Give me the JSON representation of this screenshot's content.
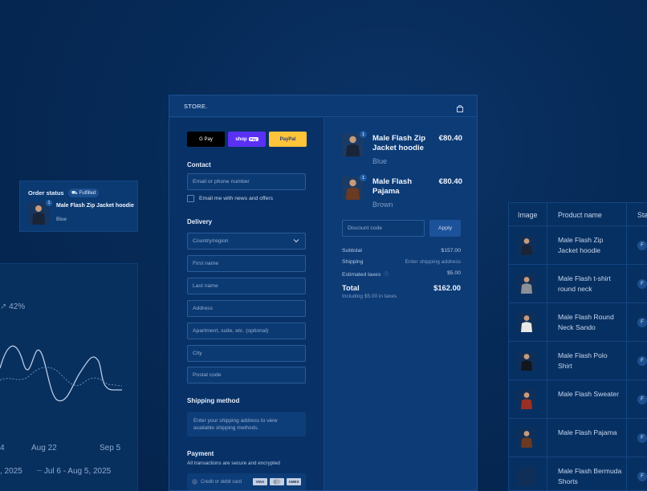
{
  "analytics": {
    "percent_label": "42%",
    "x_labels": [
      "4",
      "Aug 22",
      "Sep 5"
    ],
    "legend": [
      ", 2025",
      "Jul 6 - Aug 5, 2025"
    ]
  },
  "order_card": {
    "label": "Order status",
    "badge": "Fulfilled",
    "quantity": "1",
    "product": "Male Flash Zip Jacket hoodie",
    "variant": "Blue"
  },
  "checkout": {
    "brand": "STORE.",
    "express": {
      "gpay": "G Pay",
      "shoppay": "shop",
      "paypal": "PayPal"
    },
    "contact": {
      "title": "Contact",
      "email_placeholder": "Email or phone number",
      "newsletter_label": "Email me with news and offers"
    },
    "delivery": {
      "title": "Delivery",
      "country_placeholder": "Country/region",
      "first_name": "First name",
      "last_name": "Last name",
      "address": "Address",
      "apartment": "Apartment, suite, etc. (optional)",
      "city": "City",
      "postal": "Postal code"
    },
    "shipping": {
      "title": "Shipping method",
      "note": "Enter your shipping address to view available shipping methods."
    },
    "payment": {
      "title": "Payment",
      "subtitle": "All transactions are secure and encrypted",
      "card_label": "Credit or debit card",
      "cards": [
        "VISA",
        "",
        "AMEX"
      ]
    },
    "items": [
      {
        "name": "Male Flash Zip Jacket hoodie",
        "variant": "Blue",
        "price": "€80.40",
        "quantity": "1"
      },
      {
        "name": "Male Flash Pajama",
        "variant": "Brown",
        "price": "€80.40",
        "quantity": "1"
      }
    ],
    "discount_placeholder": "Discount code",
    "apply_label": "Apply",
    "summary": {
      "subtotal_label": "Subtotal",
      "subtotal": "$157.00",
      "shipping_label": "Shipping",
      "shipping": "Enter shipping address",
      "taxes_label": "Estimated taxes",
      "taxes": "$5.00",
      "total_label": "Total",
      "total": "$162.00",
      "tax_note": "Including $5.00 in taxes"
    }
  },
  "product_table": {
    "headers": [
      "Image",
      "Product name",
      "Sta"
    ],
    "rows": [
      {
        "name": "Male Flash Zip Jacket hoodie",
        "shirt": "#1a2438"
      },
      {
        "name": "Male Flash t-shirt round neck",
        "shirt": "#8c9098"
      },
      {
        "name": "Male Flash Round Neck Sando",
        "shirt": "#e8e8e6"
      },
      {
        "name": "Male Flash Polo Shirt",
        "shirt": "#12161f"
      },
      {
        "name": "Male Flash Sweater",
        "shirt": "#9a2f26"
      },
      {
        "name": "Male Flash Pajama",
        "shirt": "#6b3a22"
      },
      {
        "name": "Male Flash Bermuda Shorts",
        "shirt": "#0f2f59"
      }
    ],
    "status_glyph": "F"
  }
}
